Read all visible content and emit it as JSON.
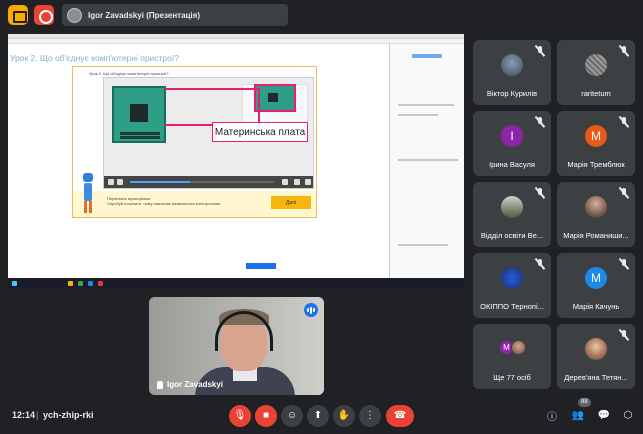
{
  "top_bar": {
    "presenter_label": "Igor Zavadskyi (Презентація)"
  },
  "presentation": {
    "lesson_title": "Урок 2. Що об'єднує комп'ютерні пристрої?",
    "slide_question": "Урок 2. Що об'єднує комп'ютерні пристрої?",
    "slide_label": "Материнська плата",
    "footer_text_1": "Переглянь мультфільм.",
    "footer_text_2": "Спробуй пояснити, чому паяльник називається електронною.",
    "next_button": "Далі",
    "video_progress": 0.42
  },
  "self_view": {
    "name": "Igor Zavadskyi"
  },
  "participants": [
    {
      "name": "Віктор Курилів",
      "initial": "",
      "color": "",
      "muted": true
    },
    {
      "name": "raritetum",
      "initial": "",
      "color": "",
      "muted": true
    },
    {
      "name": "Ірина Васуля",
      "initial": "І",
      "color": "#8e24aa",
      "muted": true
    },
    {
      "name": "Марія Тремблюк",
      "initial": "М",
      "color": "#e8591a",
      "muted": true
    },
    {
      "name": "Відділ освіти Ве...",
      "initial": "",
      "color": "",
      "muted": true
    },
    {
      "name": "Марія Романиши...",
      "initial": "",
      "color": "",
      "muted": true
    },
    {
      "name": "ОКІППО Тернопі...",
      "initial": "",
      "color": "",
      "muted": true
    },
    {
      "name": "Марія Качунь",
      "initial": "М",
      "color": "#1e88e5",
      "muted": true
    },
    {
      "name": "Ще 77 осіб",
      "initial": "М",
      "color": "#8e24aa",
      "muted": false
    },
    {
      "name": "Дерев'яна Тетян...",
      "initial": "",
      "color": "",
      "muted": true
    }
  ],
  "bottom_bar": {
    "time": "12:14",
    "separator": "|",
    "meeting_code": "ych-zhip-rki",
    "participant_count": "88"
  }
}
